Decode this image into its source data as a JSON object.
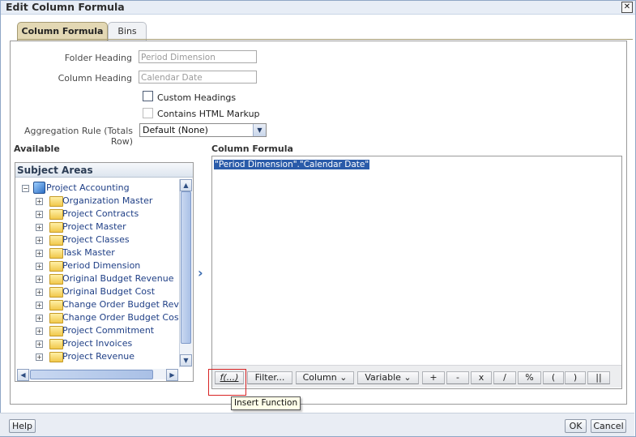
{
  "dialog": {
    "title": "Edit Column Formula",
    "close_glyph": "✕"
  },
  "tabs": [
    {
      "label": "Column Formula",
      "active": true
    },
    {
      "label": "Bins",
      "active": false
    }
  ],
  "form": {
    "folder_heading_label": "Folder Heading",
    "folder_heading_value": "Period Dimension",
    "column_heading_label": "Column Heading",
    "column_heading_value": "Calendar Date",
    "custom_headings_label": "Custom Headings",
    "custom_headings_checked": false,
    "html_markup_label": "Contains HTML Markup",
    "html_markup_checked": false,
    "aggregation_label": "Aggregation Rule (Totals Row)",
    "aggregation_value": "Default (None)"
  },
  "available": {
    "heading": "Available",
    "subject_areas_title": "Subject Areas",
    "root": "Project Accounting",
    "folders": [
      "Organization Master",
      "Project Contracts",
      "Project Master",
      "Project Classes",
      "Task Master",
      "Period Dimension",
      "Original Budget Revenue",
      "Original Budget Cost",
      "Change Order Budget Revenue",
      "Change Order Budget Cost",
      "Project Commitment",
      "Project Invoices",
      "Project Revenue"
    ]
  },
  "formula": {
    "heading": "Column Formula",
    "text": "\"Period Dimension\".\"Calendar Date\""
  },
  "toolbar": {
    "fx": "f(...)",
    "filter": "Filter...",
    "column": "Column ⌄",
    "variable": "Variable ⌄",
    "plus": "+",
    "minus": "-",
    "times": "x",
    "divide": "/",
    "percent": "%",
    "lparen": "(",
    "rparen": ")",
    "concat": "||"
  },
  "tooltip": "Insert Function",
  "footer": {
    "help": "Help",
    "ok": "OK",
    "cancel": "Cancel"
  },
  "icons": {
    "add_arrow": "chevron-right-icon",
    "root": "cube-icon",
    "folder": "folder-icon"
  }
}
